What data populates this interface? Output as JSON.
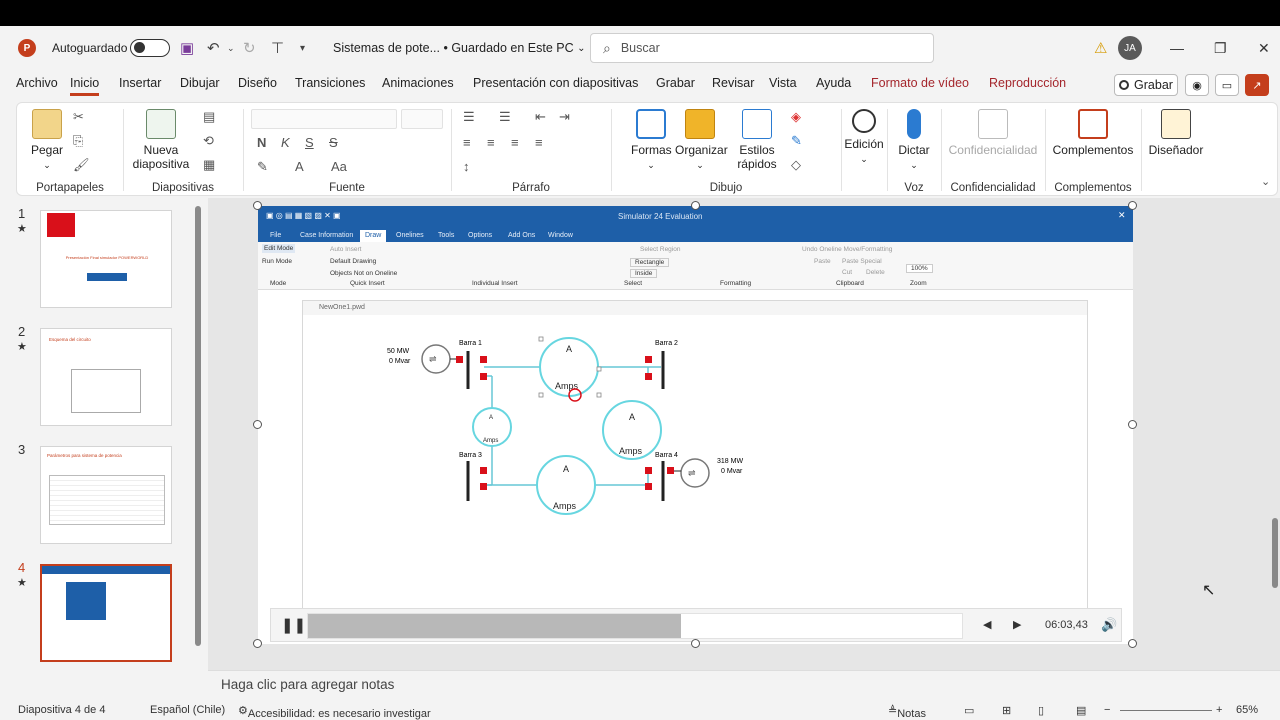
{
  "titlebar": {
    "autosave_label": "Autoguardado",
    "doc_title": "Sistemas de pote... • Guardado en Este PC",
    "search_placeholder": "Buscar",
    "avatar_initials": "JA"
  },
  "tabs": [
    "Archivo",
    "Inicio",
    "Insertar",
    "Dibujar",
    "Diseño",
    "Transiciones",
    "Animaciones",
    "Presentación con diapositivas",
    "Grabar",
    "Revisar",
    "Vista",
    "Ayuda",
    "Formato de vídeo",
    "Reproducción"
  ],
  "active_tab": "Inicio",
  "record_button": "Grabar",
  "ribbon": {
    "pegar": "Pegar",
    "nueva_diapositiva": "Nueva diapositiva",
    "formas": "Formas",
    "organizar": "Organizar",
    "estilos_rapidos": "Estilos rápidos",
    "edicion": "Edición",
    "dictar": "Dictar",
    "confidencialidad": "Confidencialidad",
    "complementos": "Complementos",
    "disenador": "Diseñador",
    "groups": {
      "portapapeles": "Portapapeles",
      "diapositivas": "Diapositivas",
      "fuente": "Fuente",
      "parrafo": "Párrafo",
      "dibujo": "Dibujo",
      "voz": "Voz",
      "confidencialidad": "Confidencialidad",
      "complementos": "Complementos"
    }
  },
  "thumbnails": [
    {
      "num": "1",
      "title": "Presentación Final simulador POWERWORLD"
    },
    {
      "num": "2",
      "title": "Esquema del circuito"
    },
    {
      "num": "3",
      "title": "Parámetros para sistema de potencia"
    },
    {
      "num": "4",
      "title": ""
    }
  ],
  "simulator": {
    "window_title": "Simulator 24 Evaluation",
    "tabs": [
      "File",
      "Case Information",
      "Draw",
      "Onelines",
      "Tools",
      "Options",
      "Add Ons",
      "Window"
    ],
    "active_tab": "Draw",
    "mode_buttons": [
      "Edit Mode",
      "Run Mode"
    ],
    "mode_label": "Mode",
    "quick_insert": [
      "Auto Insert",
      "Default Drawing",
      "Objects Not on Oneline"
    ],
    "quick_insert_label": "Quick Insert",
    "individual_insert_label": "Individual Insert",
    "select_label": "Select",
    "formatting_label": "Formatting",
    "clipboard_label": "Clipboard",
    "zoom_label": "Zoom",
    "zoom_value": "100%",
    "select_options": [
      "Select Region",
      "Rectangle",
      "Inside"
    ],
    "clipboard_items": [
      "Paste",
      "Paste Special",
      "Cut",
      "Delete"
    ],
    "undo_label": "Undo Oneline Move/Formatting",
    "oneline_title": "NewOne1.pwd",
    "buses": [
      "Barra 1",
      "Barra 2",
      "Barra 3",
      "Barra 4"
    ],
    "gen1": {
      "mw": "50 MW",
      "mvar": "0 Mvar"
    },
    "load4": {
      "mw": "318 MW",
      "mvar": "0 Mvar"
    },
    "amp_label": "A",
    "amps_label": "Amps"
  },
  "player": {
    "time": "06:03,43",
    "progress": 0.57
  },
  "notes_placeholder": "Haga clic para agregar notas",
  "status": {
    "slide": "Diapositiva 4 de 4",
    "language": "Español (Chile)",
    "accessibility": "Accesibilidad: es necesario investigar",
    "notes": "Notas",
    "zoom": "65%"
  },
  "colors": {
    "accent": "#c43e1c",
    "sim_blue": "#1e5fa8",
    "line_cyan": "#67c7d6",
    "bus_red": "#d9101a"
  }
}
